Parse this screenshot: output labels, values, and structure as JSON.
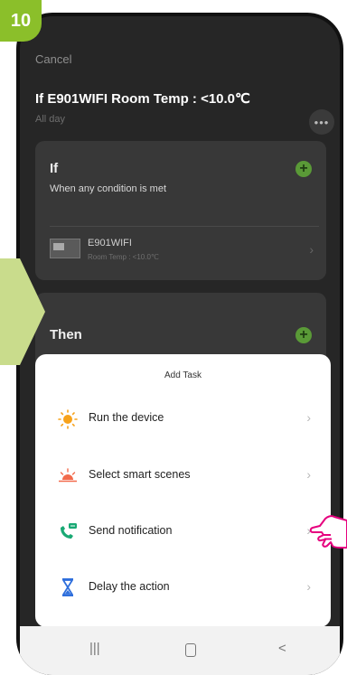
{
  "step": {
    "number": "10"
  },
  "header": {
    "cancel_label": "Cancel",
    "title": "If E901WIFI Room Temp : <10.0℃",
    "subtitle": "All day",
    "more_icon": "more-dots-icon"
  },
  "if_card": {
    "heading": "If",
    "condition": "When any condition is met",
    "device": {
      "name": "E901WIFI",
      "detail": "Room Temp : <10.0℃"
    }
  },
  "then_card": {
    "heading": "Then"
  },
  "sheet": {
    "title": "Add Task",
    "tasks": [
      {
        "label": "Run the device",
        "icon": "sun-icon"
      },
      {
        "label": "Select smart scenes",
        "icon": "sunrise-icon"
      },
      {
        "label": "Send notification",
        "icon": "phone-notification-icon"
      },
      {
        "label": "Delay the action",
        "icon": "hourglass-icon"
      }
    ]
  },
  "navbar": {
    "recents": "|||",
    "back": "<"
  },
  "colors": {
    "accent_green": "#8bbf2a",
    "dark_bg": "#262626",
    "card_bg": "#383838",
    "pointer_pink": "#e6007e"
  }
}
